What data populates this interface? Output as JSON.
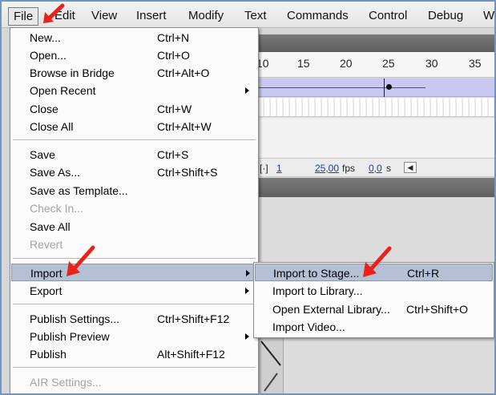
{
  "menubar": {
    "items": [
      "File",
      "Edit",
      "View",
      "Insert",
      "Modify",
      "Text",
      "Commands",
      "Control",
      "Debug",
      "W"
    ]
  },
  "file_menu": {
    "items": [
      {
        "label": "New...",
        "shortcut": "Ctrl+N"
      },
      {
        "label": "Open...",
        "shortcut": "Ctrl+O"
      },
      {
        "label": "Browse in Bridge",
        "shortcut": "Ctrl+Alt+O"
      },
      {
        "label": "Open Recent",
        "shortcut": ""
      },
      {
        "label": "Close",
        "shortcut": "Ctrl+W"
      },
      {
        "label": "Close All",
        "shortcut": "Ctrl+Alt+W"
      },
      {
        "label": "Save",
        "shortcut": "Ctrl+S"
      },
      {
        "label": "Save As...",
        "shortcut": "Ctrl+Shift+S"
      },
      {
        "label": "Save as Template...",
        "shortcut": ""
      },
      {
        "label": "Check In...",
        "shortcut": ""
      },
      {
        "label": "Save All",
        "shortcut": ""
      },
      {
        "label": "Revert",
        "shortcut": ""
      },
      {
        "label": "Import",
        "shortcut": ""
      },
      {
        "label": "Export",
        "shortcut": ""
      },
      {
        "label": "Publish Settings...",
        "shortcut": "Ctrl+Shift+F12"
      },
      {
        "label": "Publish Preview",
        "shortcut": ""
      },
      {
        "label": "Publish",
        "shortcut": "Alt+Shift+F12"
      },
      {
        "label": "AIR Settings...",
        "shortcut": ""
      }
    ]
  },
  "import_submenu": {
    "items": [
      {
        "label": "Import to Stage...",
        "shortcut": "Ctrl+R"
      },
      {
        "label": "Import to Library...",
        "shortcut": ""
      },
      {
        "label": "Open External Library...",
        "shortcut": "Ctrl+Shift+O"
      },
      {
        "label": "Import Video...",
        "shortcut": ""
      }
    ]
  },
  "timeline": {
    "ruler_ticks": [
      "10",
      "15",
      "20",
      "25",
      "30",
      "35"
    ],
    "current_frame": "1",
    "fps_value": "25,00",
    "fps_unit": "fps",
    "time_value": "0,0",
    "time_unit": "s",
    "nav_glyph": "◀"
  },
  "colors": {
    "highlight": "#b4c1d4",
    "annotation_arrow": "#e8231b",
    "frames_band": "#c8c8f0"
  }
}
